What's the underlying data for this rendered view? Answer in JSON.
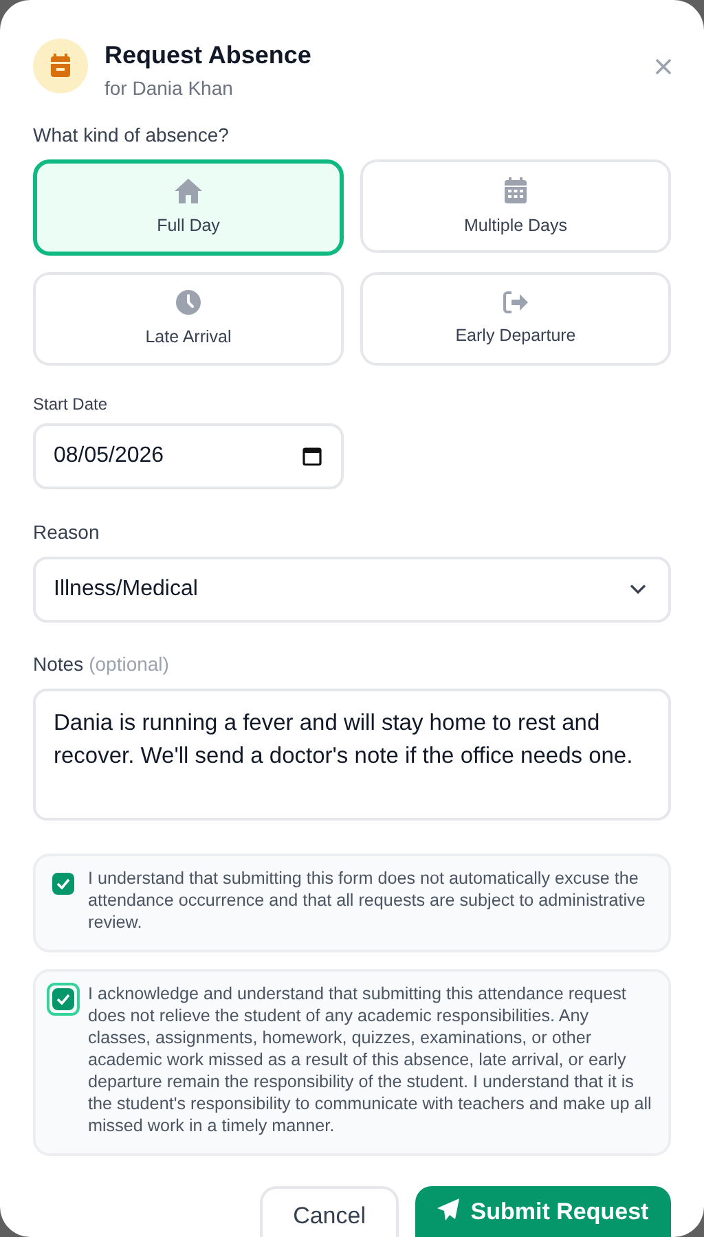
{
  "header": {
    "title": "Request Absence",
    "subtitle": "for Dania Khan"
  },
  "absence_type": {
    "label": "What kind of absence?",
    "options": [
      {
        "label": "Full Day",
        "selected": true
      },
      {
        "label": "Multiple Days",
        "selected": false
      },
      {
        "label": "Late Arrival",
        "selected": false
      },
      {
        "label": "Early Departure",
        "selected": false
      }
    ]
  },
  "start_date": {
    "label": "Start Date",
    "value": "08/05/2026"
  },
  "reason": {
    "label": "Reason",
    "value": "Illness/Medical"
  },
  "notes": {
    "label": "Notes",
    "hint": "(optional)",
    "value": "Dania is running a fever and will stay home to rest and recover. We'll send a doctor's note if the office needs one."
  },
  "acknowledgements": [
    {
      "text": "I understand that submitting this form does not automatically excuse the attendance occurrence and that all requests are subject to administrative review.",
      "checked": true,
      "focused": false
    },
    {
      "text": "I acknowledge and understand that submitting this attendance request does not relieve the student of any academic responsibilities. Any classes, assignments, homework, quizzes, examinations, or other academic work missed as a result of this absence, late arrival, or early departure remain the responsibility of the student. I understand that it is the student's responsibility to communicate with teachers and make up all missed work in a timely manner.",
      "checked": true,
      "focused": true
    }
  ],
  "buttons": {
    "cancel": "Cancel",
    "submit": "Submit Request"
  }
}
